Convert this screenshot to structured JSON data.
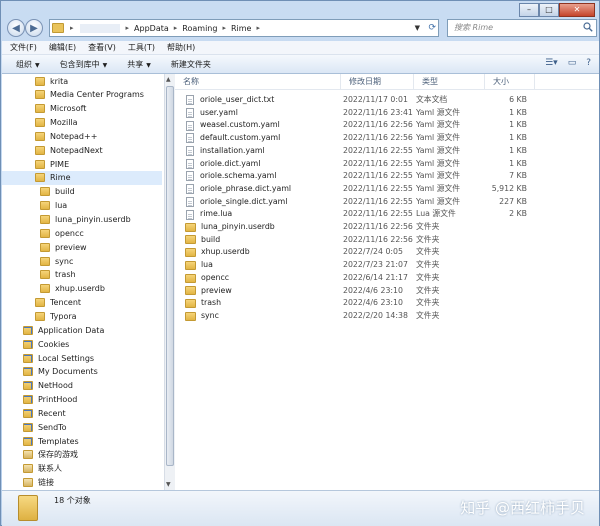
{
  "address": {
    "crumbs": [
      "AppData",
      "Roaming",
      "Rime"
    ],
    "search_placeholder": "搜索 Rime"
  },
  "menubar": [
    "文件(F)",
    "编辑(E)",
    "查看(V)",
    "工具(T)",
    "帮助(H)"
  ],
  "toolbar": {
    "organize": "组织",
    "include_library": "包含到库中",
    "share": "共享",
    "new_folder": "新建文件夹"
  },
  "columns": {
    "name": "名称",
    "modified": "修改日期",
    "type": "类型",
    "size": "大小"
  },
  "sidebar": [
    {
      "label": "krita",
      "icon": "folder",
      "indent": 1
    },
    {
      "label": "Media Center Programs",
      "icon": "folder",
      "indent": 1
    },
    {
      "label": "Microsoft",
      "icon": "folder",
      "indent": 1
    },
    {
      "label": "Mozilla",
      "icon": "folder",
      "indent": 1
    },
    {
      "label": "Notepad++",
      "icon": "folder",
      "indent": 1
    },
    {
      "label": "NotepadNext",
      "icon": "folder",
      "indent": 1
    },
    {
      "label": "PIME",
      "icon": "folder",
      "indent": 1
    },
    {
      "label": "Rime",
      "icon": "folder",
      "indent": 1,
      "selected": true
    },
    {
      "label": "build",
      "icon": "folder",
      "indent": 2
    },
    {
      "label": "lua",
      "icon": "folder",
      "indent": 2
    },
    {
      "label": "luna_pinyin.userdb",
      "icon": "folder",
      "indent": 2
    },
    {
      "label": "opencc",
      "icon": "folder",
      "indent": 2
    },
    {
      "label": "preview",
      "icon": "folder",
      "indent": 2
    },
    {
      "label": "sync",
      "icon": "folder",
      "indent": 2
    },
    {
      "label": "trash",
      "icon": "folder",
      "indent": 2
    },
    {
      "label": "xhup.userdb",
      "icon": "folder",
      "indent": 2
    },
    {
      "label": "Tencent",
      "icon": "folder",
      "indent": 1
    },
    {
      "label": "Typora",
      "icon": "folder",
      "indent": 1
    },
    {
      "label": "Application Data",
      "icon": "shortcut",
      "indent": 0
    },
    {
      "label": "Cookies",
      "icon": "shortcut",
      "indent": 0
    },
    {
      "label": "Local Settings",
      "icon": "shortcut",
      "indent": 0
    },
    {
      "label": "My Documents",
      "icon": "shortcut",
      "indent": 0
    },
    {
      "label": "NetHood",
      "icon": "shortcut",
      "indent": 0
    },
    {
      "label": "PrintHood",
      "icon": "shortcut",
      "indent": 0
    },
    {
      "label": "Recent",
      "icon": "shortcut",
      "indent": 0
    },
    {
      "label": "SendTo",
      "icon": "shortcut",
      "indent": 0
    },
    {
      "label": "Templates",
      "icon": "shortcut",
      "indent": 0
    },
    {
      "label": "保存的游戏",
      "icon": "special",
      "indent": 0
    },
    {
      "label": "联系人",
      "icon": "special",
      "indent": 0
    },
    {
      "label": "链接",
      "icon": "special",
      "indent": 0
    }
  ],
  "files": [
    {
      "name": "oriole_user_dict.txt",
      "date": "2022/11/17 0:01",
      "type": "文本文档",
      "size": "6 KB",
      "kind": "doc"
    },
    {
      "name": "user.yaml",
      "date": "2022/11/16 23:41",
      "type": "Yaml 源文件",
      "size": "1 KB",
      "kind": "doc"
    },
    {
      "name": "weasel.custom.yaml",
      "date": "2022/11/16 22:56",
      "type": "Yaml 源文件",
      "size": "1 KB",
      "kind": "doc"
    },
    {
      "name": "default.custom.yaml",
      "date": "2022/11/16 22:56",
      "type": "Yaml 源文件",
      "size": "1 KB",
      "kind": "doc"
    },
    {
      "name": "installation.yaml",
      "date": "2022/11/16 22:55",
      "type": "Yaml 源文件",
      "size": "1 KB",
      "kind": "doc"
    },
    {
      "name": "oriole.dict.yaml",
      "date": "2022/11/16 22:55",
      "type": "Yaml 源文件",
      "size": "1 KB",
      "kind": "doc"
    },
    {
      "name": "oriole.schema.yaml",
      "date": "2022/11/16 22:55",
      "type": "Yaml 源文件",
      "size": "7 KB",
      "kind": "doc"
    },
    {
      "name": "oriole_phrase.dict.yaml",
      "date": "2022/11/16 22:55",
      "type": "Yaml 源文件",
      "size": "5,912 KB",
      "kind": "doc"
    },
    {
      "name": "oriole_single.dict.yaml",
      "date": "2022/11/16 22:55",
      "type": "Yaml 源文件",
      "size": "227 KB",
      "kind": "doc"
    },
    {
      "name": "rime.lua",
      "date": "2022/11/16 22:55",
      "type": "Lua 源文件",
      "size": "2 KB",
      "kind": "doc"
    },
    {
      "name": "luna_pinyin.userdb",
      "date": "2022/11/16 22:56",
      "type": "文件夹",
      "size": "",
      "kind": "folder"
    },
    {
      "name": "build",
      "date": "2022/11/16 22:56",
      "type": "文件夹",
      "size": "",
      "kind": "folder"
    },
    {
      "name": "xhup.userdb",
      "date": "2022/7/24 0:05",
      "type": "文件夹",
      "size": "",
      "kind": "folder"
    },
    {
      "name": "lua",
      "date": "2022/7/23 21:07",
      "type": "文件夹",
      "size": "",
      "kind": "folder"
    },
    {
      "name": "opencc",
      "date": "2022/6/14 21:17",
      "type": "文件夹",
      "size": "",
      "kind": "folder"
    },
    {
      "name": "preview",
      "date": "2022/4/6 23:10",
      "type": "文件夹",
      "size": "",
      "kind": "folder"
    },
    {
      "name": "trash",
      "date": "2022/4/6 23:10",
      "type": "文件夹",
      "size": "",
      "kind": "folder"
    },
    {
      "name": "sync",
      "date": "2022/2/20 14:38",
      "type": "文件夹",
      "size": "",
      "kind": "folder"
    }
  ],
  "status": {
    "count": "18 个对象"
  },
  "watermark": "知乎 @西红柿手贝"
}
